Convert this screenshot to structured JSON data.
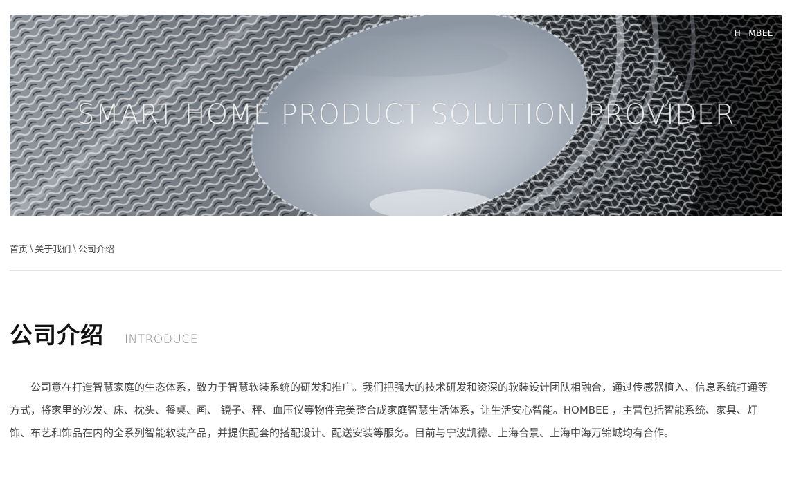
{
  "banner": {
    "title": "SMART HOME PRODUCT SOLUTION PROVIDER",
    "brand_prefix": "H",
    "brand_suffix": "MBEE",
    "brand_icon": "hexagon-o-icon"
  },
  "breadcrumb": {
    "items": [
      "首页",
      "关于我们",
      "公司介绍"
    ],
    "separator": "\\"
  },
  "section": {
    "title": "公司介绍",
    "subtitle": "INTRODUCE"
  },
  "intro": {
    "text": "公司意在打造智慧家庭的生态体系，致力于智慧软装系统的研发和推广。我们把强大的技术研发和资深的软装设计团队相融合，通过传感器植入、信息系统打通等方式，将家里的沙发、床、枕头、餐桌、画、 镜子、秤、血压仪等物件完美整合成家庭智慧生活体系，让生活安心智能。HOMBEE ，主营包括智能系统、家具、灯饰、布艺和饰品在内的全系列智能软装产品，并提供配套的搭配设计、配送安装等服务。目前与宁波凯德、上海合景、上海中海万锦城均有合作。"
  },
  "colors": {
    "brand_accent": "#c0392b",
    "text": "#444444",
    "heading": "#111111",
    "subtitle": "#8a8a8a"
  }
}
